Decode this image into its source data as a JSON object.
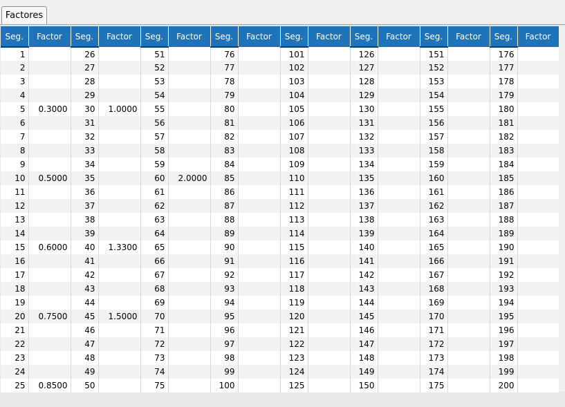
{
  "tab": {
    "label": "Factores"
  },
  "table": {
    "headers": [
      "Seg.",
      "Factor",
      "Seg.",
      "Factor",
      "Seg.",
      "Factor",
      "Seg.",
      "Factor",
      "Seg.",
      "Factor",
      "Seg.",
      "Factor",
      "Seg.",
      "Factor",
      "Seg.",
      "Factor"
    ],
    "rows": [
      [
        "1",
        "",
        "26",
        "",
        "51",
        "",
        "76",
        "",
        "101",
        "",
        "126",
        "",
        "151",
        "",
        "176",
        ""
      ],
      [
        "2",
        "",
        "27",
        "",
        "52",
        "",
        "77",
        "",
        "102",
        "",
        "127",
        "",
        "152",
        "",
        "177",
        ""
      ],
      [
        "3",
        "",
        "28",
        "",
        "53",
        "",
        "78",
        "",
        "103",
        "",
        "128",
        "",
        "153",
        "",
        "178",
        ""
      ],
      [
        "4",
        "",
        "29",
        "",
        "54",
        "",
        "79",
        "",
        "104",
        "",
        "129",
        "",
        "154",
        "",
        "179",
        ""
      ],
      [
        "5",
        "0.3000",
        "30",
        "1.0000",
        "55",
        "",
        "80",
        "",
        "105",
        "",
        "130",
        "",
        "155",
        "",
        "180",
        ""
      ],
      [
        "6",
        "",
        "31",
        "",
        "56",
        "",
        "81",
        "",
        "106",
        "",
        "131",
        "",
        "156",
        "",
        "181",
        ""
      ],
      [
        "7",
        "",
        "32",
        "",
        "57",
        "",
        "82",
        "",
        "107",
        "",
        "132",
        "",
        "157",
        "",
        "182",
        ""
      ],
      [
        "8",
        "",
        "33",
        "",
        "58",
        "",
        "83",
        "",
        "108",
        "",
        "133",
        "",
        "158",
        "",
        "183",
        ""
      ],
      [
        "9",
        "",
        "34",
        "",
        "59",
        "",
        "84",
        "",
        "109",
        "",
        "134",
        "",
        "159",
        "",
        "184",
        ""
      ],
      [
        "10",
        "0.5000",
        "35",
        "",
        "60",
        "2.0000",
        "85",
        "",
        "110",
        "",
        "135",
        "",
        "160",
        "",
        "185",
        ""
      ],
      [
        "11",
        "",
        "36",
        "",
        "61",
        "",
        "86",
        "",
        "111",
        "",
        "136",
        "",
        "161",
        "",
        "186",
        ""
      ],
      [
        "12",
        "",
        "37",
        "",
        "62",
        "",
        "87",
        "",
        "112",
        "",
        "137",
        "",
        "162",
        "",
        "187",
        ""
      ],
      [
        "13",
        "",
        "38",
        "",
        "63",
        "",
        "88",
        "",
        "113",
        "",
        "138",
        "",
        "163",
        "",
        "188",
        ""
      ],
      [
        "14",
        "",
        "39",
        "",
        "64",
        "",
        "89",
        "",
        "114",
        "",
        "139",
        "",
        "164",
        "",
        "189",
        ""
      ],
      [
        "15",
        "0.6000",
        "40",
        "1.3300",
        "65",
        "",
        "90",
        "",
        "115",
        "",
        "140",
        "",
        "165",
        "",
        "190",
        ""
      ],
      [
        "16",
        "",
        "41",
        "",
        "66",
        "",
        "91",
        "",
        "116",
        "",
        "141",
        "",
        "166",
        "",
        "191",
        ""
      ],
      [
        "17",
        "",
        "42",
        "",
        "67",
        "",
        "92",
        "",
        "117",
        "",
        "142",
        "",
        "167",
        "",
        "192",
        ""
      ],
      [
        "18",
        "",
        "43",
        "",
        "68",
        "",
        "93",
        "",
        "118",
        "",
        "143",
        "",
        "168",
        "",
        "193",
        ""
      ],
      [
        "19",
        "",
        "44",
        "",
        "69",
        "",
        "94",
        "",
        "119",
        "",
        "144",
        "",
        "169",
        "",
        "194",
        ""
      ],
      [
        "20",
        "0.7500",
        "45",
        "1.5000",
        "70",
        "",
        "95",
        "",
        "120",
        "",
        "145",
        "",
        "170",
        "",
        "195",
        ""
      ],
      [
        "21",
        "",
        "46",
        "",
        "71",
        "",
        "96",
        "",
        "121",
        "",
        "146",
        "",
        "171",
        "",
        "196",
        ""
      ],
      [
        "22",
        "",
        "47",
        "",
        "72",
        "",
        "97",
        "",
        "122",
        "",
        "147",
        "",
        "172",
        "",
        "197",
        ""
      ],
      [
        "23",
        "",
        "48",
        "",
        "73",
        "",
        "98",
        "",
        "123",
        "",
        "148",
        "",
        "173",
        "",
        "198",
        ""
      ],
      [
        "24",
        "",
        "49",
        "",
        "74",
        "",
        "99",
        "",
        "124",
        "",
        "149",
        "",
        "174",
        "",
        "199",
        ""
      ],
      [
        "25",
        "0.8500",
        "50",
        "",
        "75",
        "",
        "100",
        "",
        "125",
        "",
        "150",
        "",
        "175",
        "",
        "200",
        ""
      ]
    ]
  }
}
